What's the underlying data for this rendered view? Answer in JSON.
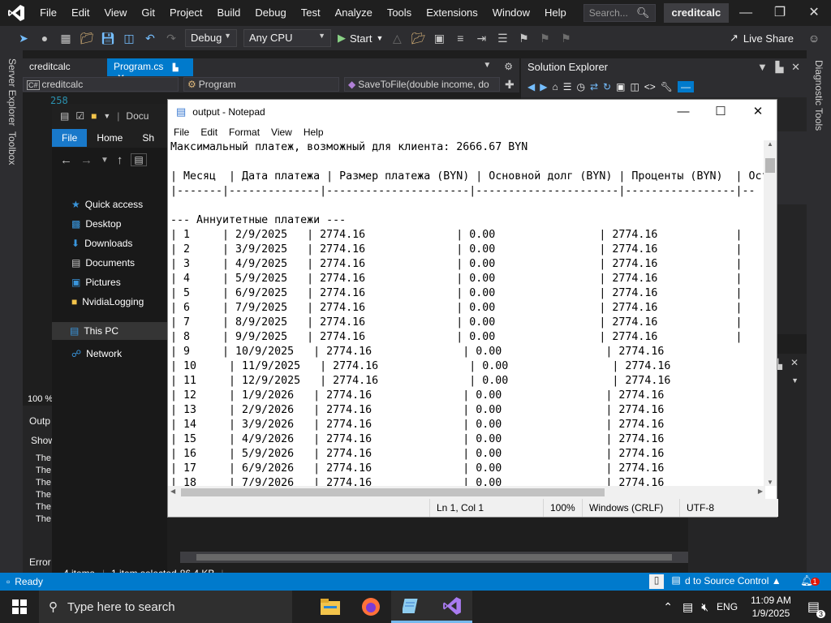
{
  "vs": {
    "menu": [
      "File",
      "Edit",
      "View",
      "Git",
      "Project",
      "Build",
      "Debug",
      "Test",
      "Analyze",
      "Tools",
      "Extensions",
      "Window",
      "Help"
    ],
    "search_placeholder": "Search...",
    "solution_name": "creditcalc",
    "config": "Debug",
    "platform": "Any CPU",
    "start_label": "Start",
    "live_share": "Live Share",
    "tabs": [
      {
        "label": "creditcalc"
      },
      {
        "label": "Program.cs"
      }
    ],
    "nav": {
      "project": "creditcalc",
      "class": "Program",
      "member": "SaveToFile(double income, do"
    },
    "line_number": "258",
    "server_explorer": "Server Explorer",
    "toolbox": "Toolbox",
    "diagnostic_tools": "Diagnostic Tools",
    "solution_explorer_title": "Solution Explorer",
    "output_title": "Outp",
    "output_show": "Show",
    "output_lines": [
      "The",
      "The",
      "The",
      "The",
      "The",
      "The"
    ],
    "error_tab": "Error",
    "zoom": "100 %",
    "status_ready": "Ready",
    "source_control": "d to Source Control",
    "notification_count": "1"
  },
  "explorer": {
    "ribbon": {
      "file": "File",
      "home": "Home",
      "share": "Sh"
    },
    "breadcrumb": "Docu",
    "nav": [
      {
        "label": "Quick access",
        "icon": "star-icon"
      },
      {
        "label": "Desktop",
        "icon": "desktop-folder-icon"
      },
      {
        "label": "Downloads",
        "icon": "downloads-icon"
      },
      {
        "label": "Documents",
        "icon": "documents-icon"
      },
      {
        "label": "Pictures",
        "icon": "pictures-icon"
      },
      {
        "label": "NvidiaLogging",
        "icon": "folder-icon"
      },
      {
        "label": "This PC",
        "icon": "pc-icon"
      },
      {
        "label": "Network",
        "icon": "network-icon"
      }
    ],
    "status": {
      "items": "4 items",
      "selected": "1 item selected",
      "size": "86.4 KB"
    }
  },
  "notepad": {
    "title": "output - Notepad",
    "menu": [
      "File",
      "Edit",
      "Format",
      "View",
      "Help"
    ],
    "lines": [
      "Максимальный платеж, возможный для клиента: 2666.67 BYN",
      "",
      "| Месяц  | Дата платежа | Размер платежа (BYN) | Основной долг (BYN) | Проценты (BYN)  | Оста",
      "|-------|--------------|----------------------|----------------------|-----------------|--",
      "",
      "--- Аннуитетные платежи ---",
      "| 1     | 2/9/2025   | 2774.16              | 0.00                | 2774.16            |",
      "| 2     | 3/9/2025   | 2774.16              | 0.00                | 2774.16            |",
      "| 3     | 4/9/2025   | 2774.16              | 0.00                | 2774.16            |",
      "| 4     | 5/9/2025   | 2774.16              | 0.00                | 2774.16            |",
      "| 5     | 6/9/2025   | 2774.16              | 0.00                | 2774.16            |",
      "| 6     | 7/9/2025   | 2774.16              | 0.00                | 2774.16            |",
      "| 7     | 8/9/2025   | 2774.16              | 0.00                | 2774.16            |",
      "| 8     | 9/9/2025   | 2774.16              | 0.00                | 2774.16            |",
      "| 9     | 10/9/2025   | 2774.16              | 0.00                | 2774.16",
      "| 10     | 11/9/2025   | 2774.16              | 0.00                | 2774.16",
      "| 11     | 12/9/2025   | 2774.16              | 0.00                | 2774.16",
      "| 12     | 1/9/2026   | 2774.16              | 0.00                | 2774.16",
      "| 13     | 2/9/2026   | 2774.16              | 0.00                | 2774.16",
      "| 14     | 3/9/2026   | 2774.16              | 0.00                | 2774.16",
      "| 15     | 4/9/2026   | 2774.16              | 0.00                | 2774.16",
      "| 16     | 5/9/2026   | 2774.16              | 0.00                | 2774.16",
      "| 17     | 6/9/2026   | 2774.16              | 0.00                | 2774.16",
      "| 18     | 7/9/2026   | 2774.16              | 0.00                | 2774.16"
    ],
    "status": {
      "position": "Ln 1, Col 1",
      "zoom": "100%",
      "eol": "Windows (CRLF)",
      "encoding": "UTF-8"
    }
  },
  "taskbar": {
    "search_placeholder": "Type here to search",
    "language": "ENG",
    "time": "11:09 AM",
    "date": "1/9/2025",
    "notification_count": "3"
  },
  "colors": {
    "vs_accent": "#007acc",
    "explorer_file": "#1979ca"
  }
}
